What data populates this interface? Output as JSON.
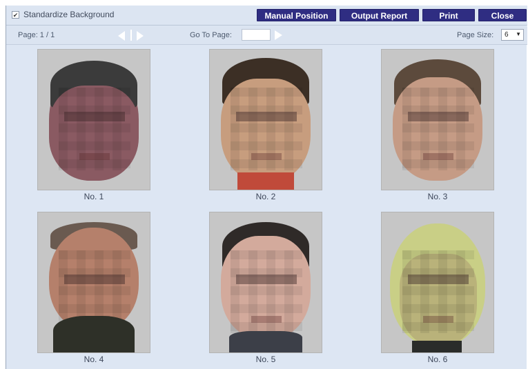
{
  "toolbar": {
    "checkbox_label": "Standardize Background",
    "checkbox_checked": true,
    "buttons": {
      "manual_position": "Manual Position",
      "output_report": "Output Report",
      "print": "Print",
      "close": "Close"
    }
  },
  "nav": {
    "page_label": "Page: 1 / 1",
    "goto_label": "Go To Page:",
    "goto_value": "",
    "page_size_label": "Page Size:",
    "page_size_value": "6"
  },
  "faces": [
    {
      "label": "No. 1",
      "skin": "#8a5a62",
      "hair": "#3b3b3b",
      "bg": "#c7c7c7"
    },
    {
      "label": "No. 2",
      "skin": "#c79d7e",
      "hair": "#3c2f25",
      "bg": "#c7c7c7"
    },
    {
      "label": "No. 3",
      "skin": "#c59b85",
      "hair": "#5c4a3c",
      "bg": "#c7c7c7"
    },
    {
      "label": "No. 4",
      "skin": "#b5806b",
      "hair": "#6a5a50",
      "bg": "#c7c7c7"
    },
    {
      "label": "No. 5",
      "skin": "#d3aa9c",
      "hair": "#2f2a28",
      "bg": "#c7c7c7"
    },
    {
      "label": "No. 6",
      "skin": "#b9b27a",
      "hair": "#c9cf86",
      "bg": "#c7c7c7"
    }
  ]
}
